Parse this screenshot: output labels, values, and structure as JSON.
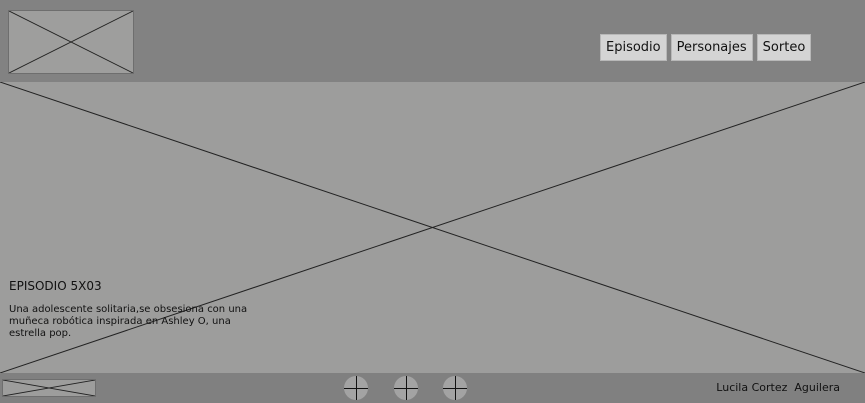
{
  "nav": {
    "items": [
      "Episodio",
      "Personajes",
      "Sorteo"
    ]
  },
  "hero": {
    "title": "EPISODIO 5X03",
    "description": "Una adolescente solitaria,se obsesiona con una muñeca robótica inspirada en Ashley O, una estrella pop."
  },
  "footer": {
    "author": "Lucila Cortez  Aguilera"
  },
  "icons": {
    "logo": "image-placeholder-icon",
    "social": [
      "crosshair-icon",
      "crosshair-icon",
      "crosshair-icon"
    ]
  }
}
